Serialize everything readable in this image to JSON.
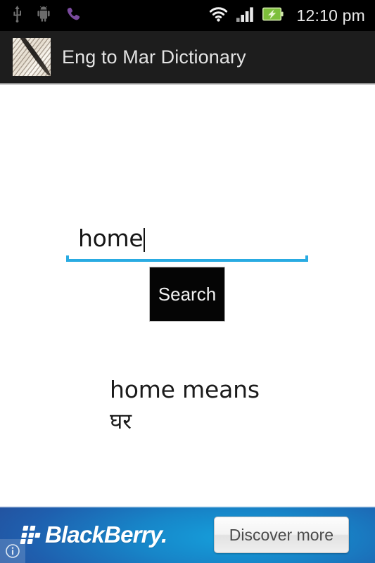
{
  "status_bar": {
    "clock": "12:10 pm",
    "left_icons": [
      {
        "name": "usb-icon",
        "label": "USB connected"
      },
      {
        "name": "android-robot-icon",
        "label": "Android system"
      },
      {
        "name": "missed-call-icon",
        "label": "Missed call"
      }
    ],
    "right_icons": [
      {
        "name": "wifi-icon",
        "label": "Wi-Fi signal"
      },
      {
        "name": "cellular-signal-icon",
        "label": "Cellular signal"
      },
      {
        "name": "battery-charging-icon",
        "label": "Battery charging"
      }
    ],
    "colors": {
      "background": "#000000",
      "text": "#e9e9e9",
      "battery": "#7cc242"
    }
  },
  "title_bar": {
    "app_title": "Eng to Mar Dictionary",
    "icon_name": "app-icon",
    "colors": {
      "background": "#1d1d1d",
      "text": "#e3e3e3",
      "divider": "#8f8f8f"
    }
  },
  "search": {
    "value": "home",
    "placeholder": "",
    "underline_color": "#29ABE2",
    "button_label": "Search"
  },
  "result": {
    "line_1": "home means",
    "line_2": "घर"
  },
  "ad": {
    "brand": "BlackBerry.",
    "cta_label": "Discover more",
    "info_label": "Ad information",
    "colors": {
      "blue_light": "#159fdb",
      "blue_dark": "#23529f",
      "cta_text": "#4a4a4a"
    }
  }
}
